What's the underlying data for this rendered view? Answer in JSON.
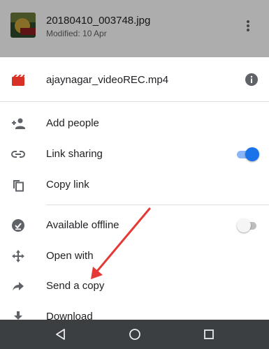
{
  "background_file": {
    "name": "20180410_003748.jpg",
    "modified": "Modified: 10 Apr"
  },
  "sheet": {
    "file_name": "ajaynagar_videoREC.mp4",
    "items": [
      {
        "label": "Add people",
        "icon": "add-person-icon"
      },
      {
        "label": "Link sharing",
        "icon": "link-icon",
        "toggle": true
      },
      {
        "label": "Copy link",
        "icon": "copy-icon"
      },
      {
        "label": "Available offline",
        "icon": "offline-check-icon",
        "toggle": false
      },
      {
        "label": "Open with",
        "icon": "move-arrows-icon"
      },
      {
        "label": "Send a copy",
        "icon": "share-arrow-icon"
      },
      {
        "label": "Download",
        "icon": "download-icon"
      }
    ]
  },
  "colors": {
    "accent": "#1a73e8",
    "video_icon": "#d93025",
    "icon_grey": "#5f6368",
    "annotation_arrow": "#e53935"
  },
  "navigation": [
    "back-icon",
    "home-icon",
    "recents-icon"
  ]
}
